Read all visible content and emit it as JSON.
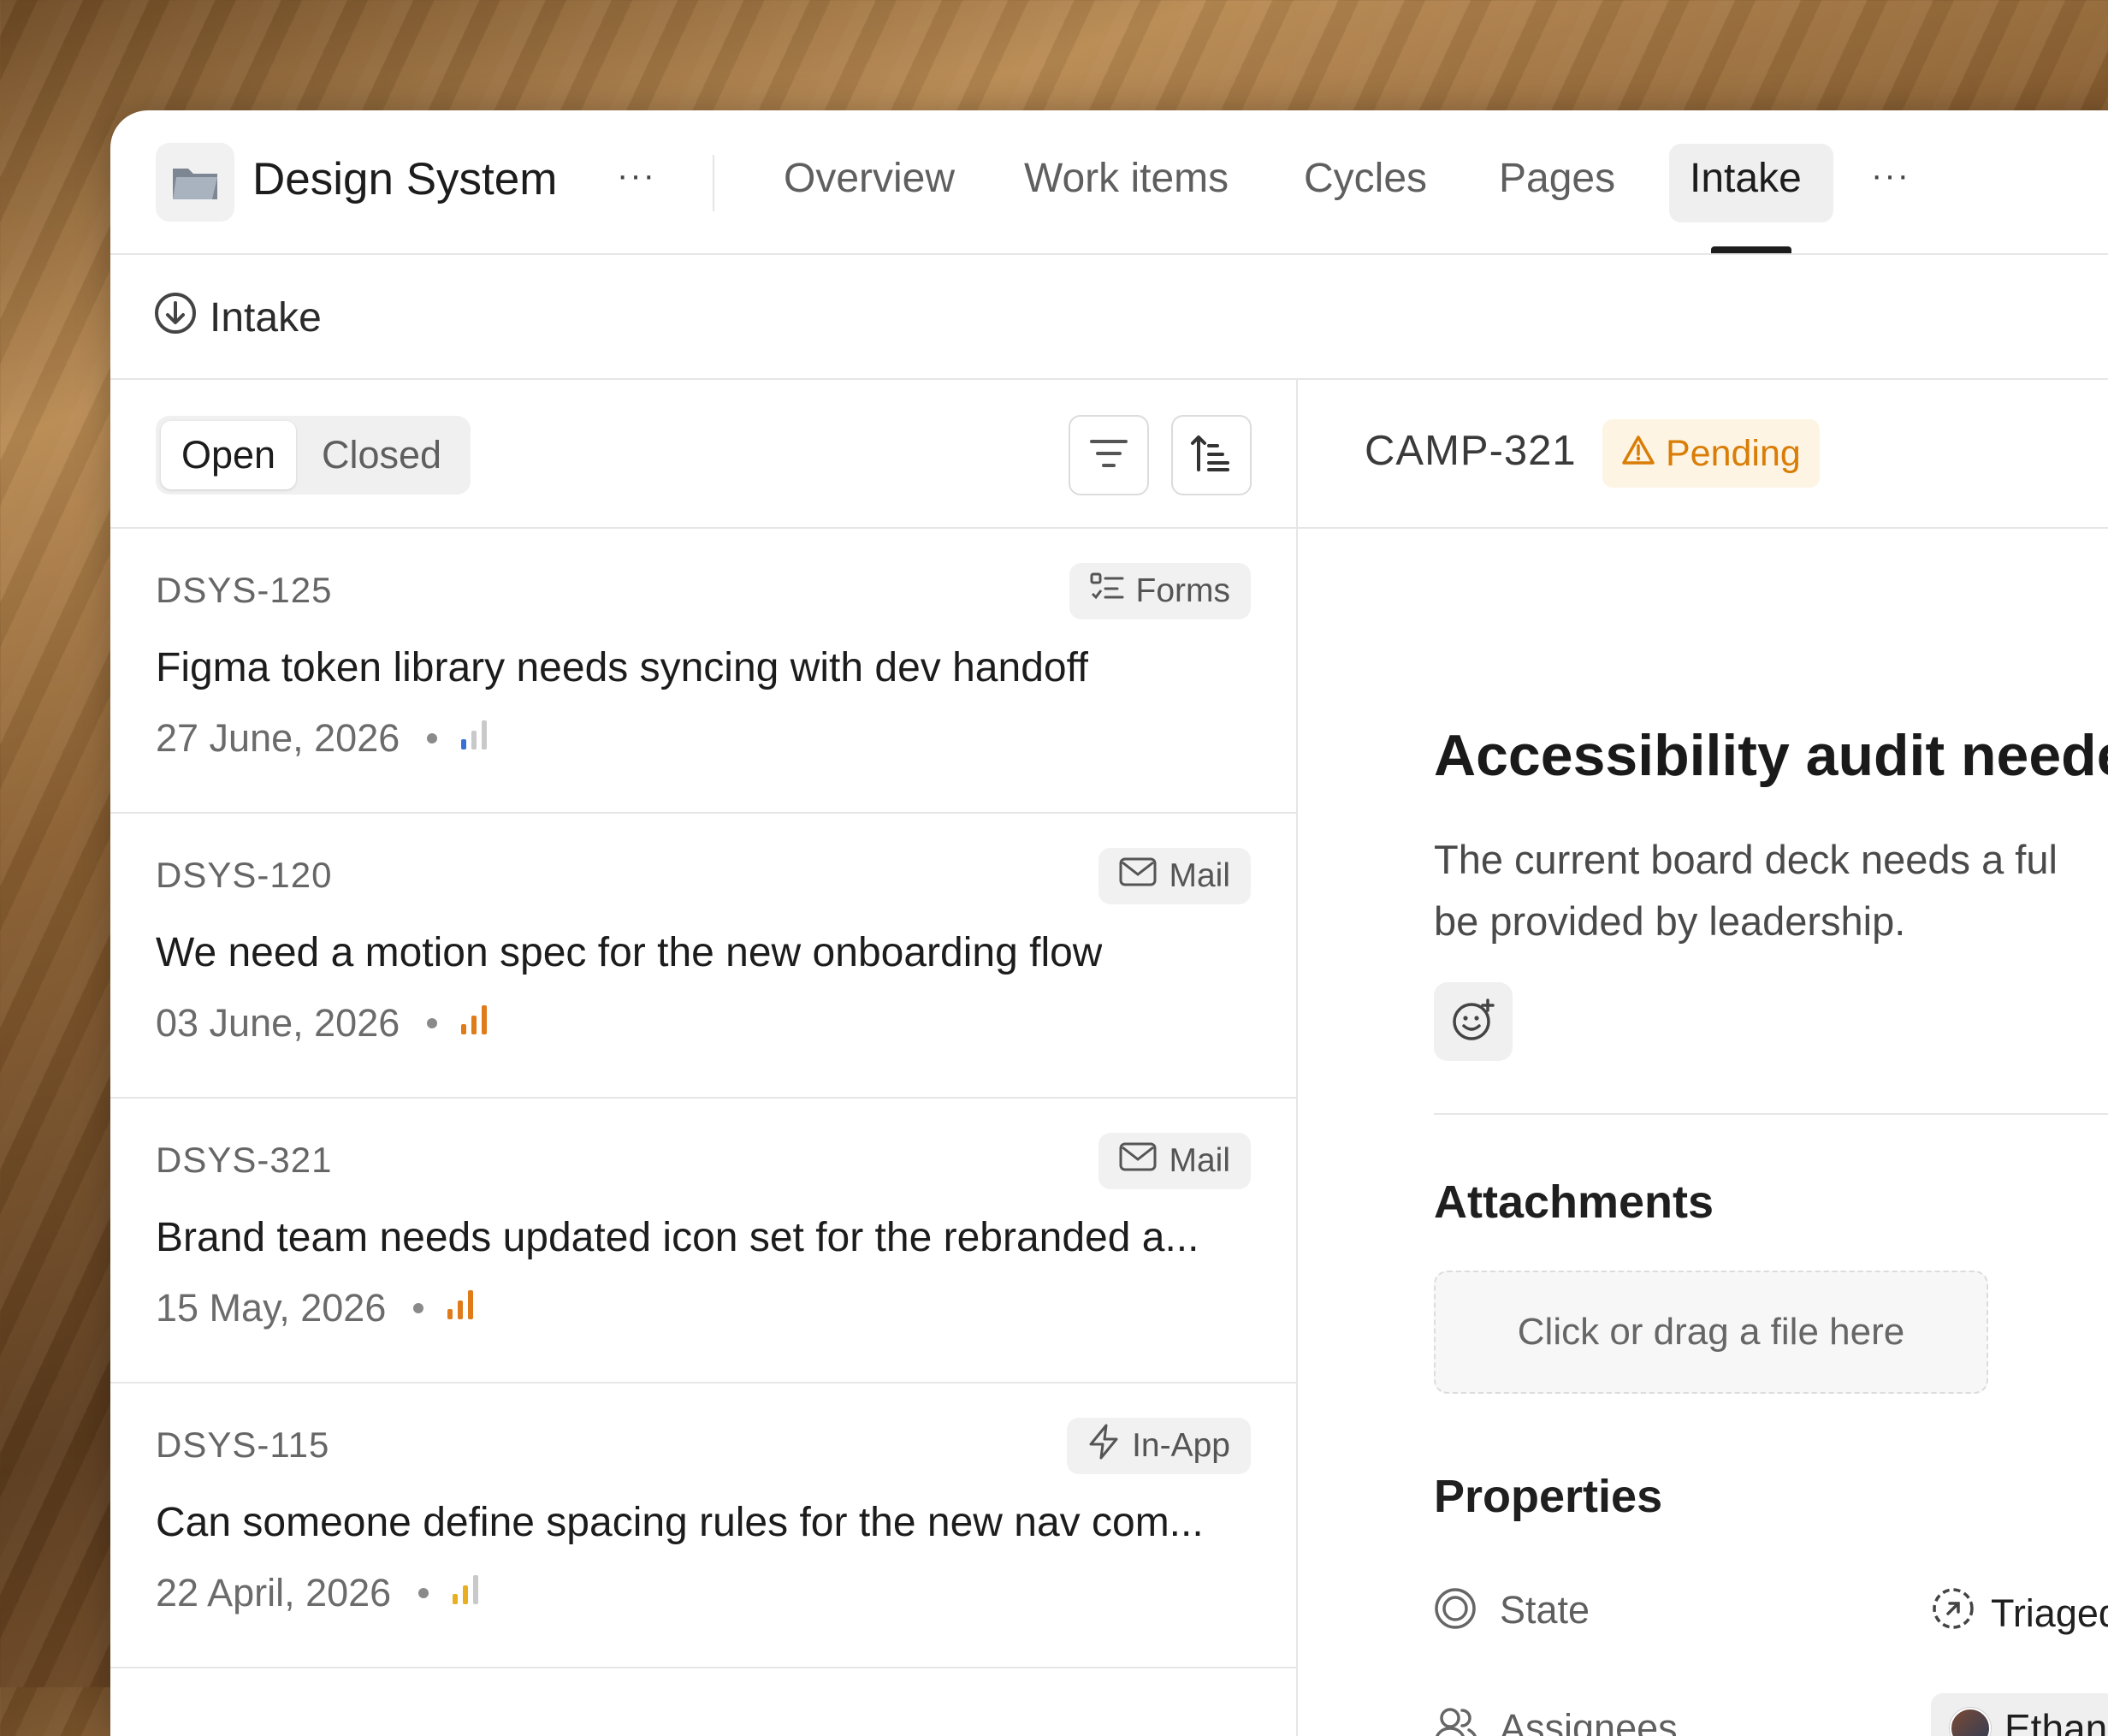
{
  "header": {
    "project_title": "Design System",
    "project_more": "···",
    "tabs": [
      "Overview",
      "Work items",
      "Cycles",
      "Pages",
      "Intake"
    ],
    "active_tab": "Intake",
    "tabs_more": "···"
  },
  "breadcrumb": {
    "label": "Intake"
  },
  "list_toolbar": {
    "open_label": "Open",
    "closed_label": "Closed"
  },
  "items": [
    {
      "id": "DSYS-125",
      "source": "Forms",
      "source_icon": "form-icon",
      "title": "Figma token library needs syncing with dev handoff",
      "date": "27 June, 2026",
      "priority": "low",
      "priority_color": "#3b6fd8"
    },
    {
      "id": "DSYS-120",
      "source": "Mail",
      "source_icon": "mail-icon",
      "title": "We need a motion spec for the new onboarding flow",
      "date": "03 June, 2026",
      "priority": "high",
      "priority_color": "#e07b1a"
    },
    {
      "id": "DSYS-321",
      "source": "Mail",
      "source_icon": "mail-icon",
      "title": "Brand team needs updated icon set for the rebranded a...",
      "date": "15 May, 2026",
      "priority": "high",
      "priority_color": "#e07b1a"
    },
    {
      "id": "DSYS-115",
      "source": "In-App",
      "source_icon": "lightning-icon",
      "title": "Can someone define spacing rules for the new nav com...",
      "date": "22 April, 2026",
      "priority": "medium",
      "priority_color": "#e8b020"
    }
  ],
  "detail": {
    "id": "CAMP-321",
    "status": "Pending",
    "title": "Accessibility audit neede",
    "description_line1": "The current board deck needs a ful",
    "description_line2": "be provided by leadership.",
    "attachments_title": "Attachments",
    "dropzone_text": "Click or drag a file here",
    "properties_title": "Properties",
    "state_label": "State",
    "state_value": "Triaged",
    "assignees_label": "Assignees",
    "assignee_name": "Ethan Parke"
  },
  "colors": {
    "accent_warning": "#d97d06",
    "warning_bg": "#fdf4e3"
  }
}
